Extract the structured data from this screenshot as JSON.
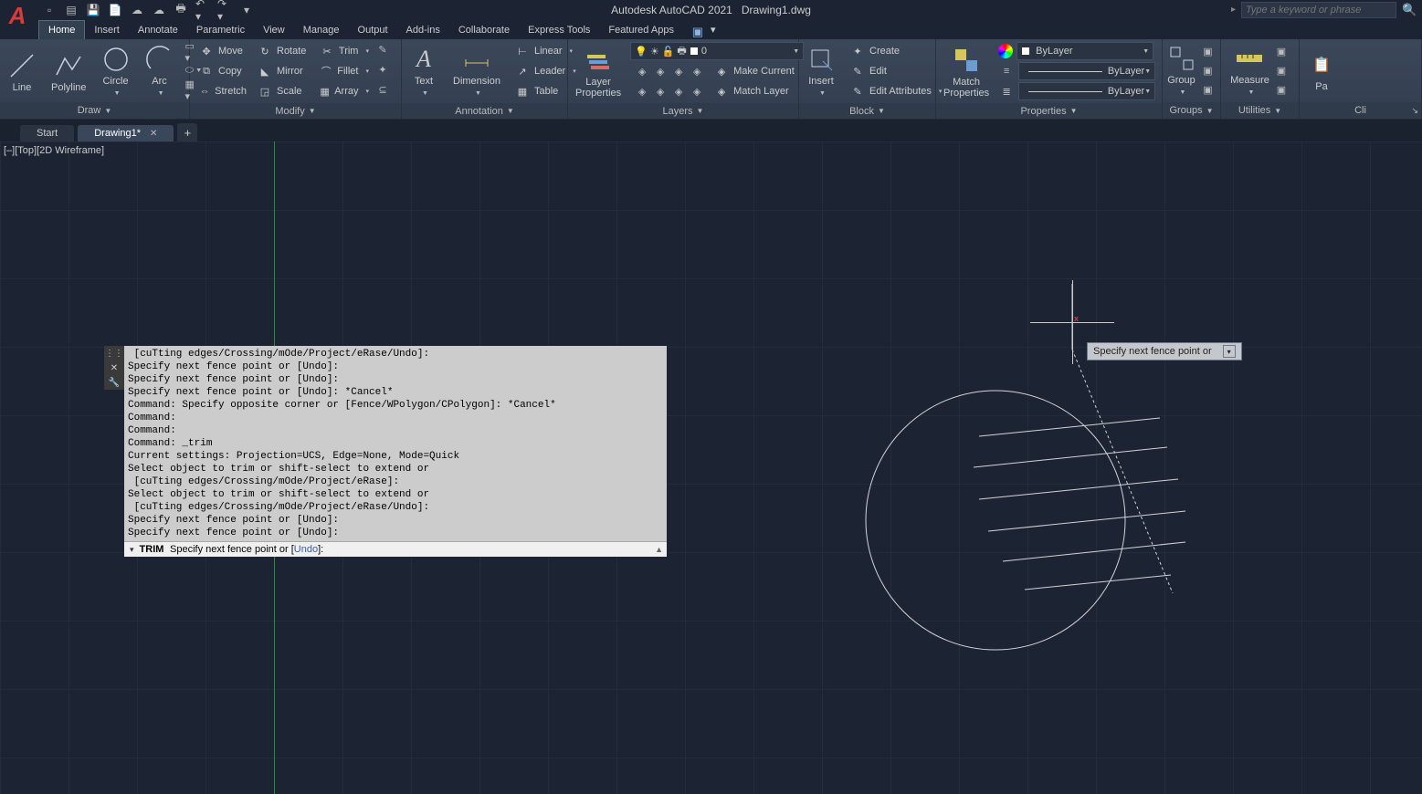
{
  "title_app": "Autodesk AutoCAD 2021",
  "title_doc": "Drawing1.dwg",
  "search_placeholder": "Type a keyword or phrase",
  "menutabs": [
    "Home",
    "Insert",
    "Annotate",
    "Parametric",
    "View",
    "Manage",
    "Output",
    "Add-ins",
    "Collaborate",
    "Express Tools",
    "Featured Apps"
  ],
  "active_menutab": 0,
  "panels": {
    "draw": {
      "label": "Draw",
      "btns": [
        "Line",
        "Polyline",
        "Circle",
        "Arc"
      ]
    },
    "modify": {
      "label": "Modify",
      "rows": [
        {
          "icon": "↔",
          "label": "Move"
        },
        {
          "icon": "↻",
          "label": "Rotate"
        },
        {
          "icon": "✂",
          "label": "Trim",
          "dd": true
        },
        {
          "icon": "⧉",
          "label": "Copy"
        },
        {
          "icon": "▲",
          "label": "Mirror"
        },
        {
          "icon": "⌒",
          "label": "Fillet",
          "dd": true
        },
        {
          "icon": "↔",
          "label": "Stretch"
        },
        {
          "icon": "⤢",
          "label": "Scale"
        },
        {
          "icon": "▦",
          "label": "Array",
          "dd": true
        }
      ]
    },
    "annotation": {
      "label": "Annotation",
      "text": "Text",
      "dim": "Dimension",
      "linear": "Linear",
      "leader": "Leader",
      "table": "Table"
    },
    "layers": {
      "label": "Layers",
      "lp": "Layer\nProperties",
      "make": "Make Current",
      "match": "Match Layer",
      "current": "0"
    },
    "block": {
      "label": "Block",
      "insert": "Insert",
      "create": "Create",
      "edit": "Edit",
      "attrs": "Edit Attributes"
    },
    "properties": {
      "label": "Properties",
      "match": "Match\nProperties",
      "bylayer": "ByLayer"
    },
    "groups": {
      "label": "Groups",
      "group": "Group"
    },
    "utilities": {
      "label": "Utilities",
      "measure": "Measure"
    },
    "clip": {
      "label": "Cli"
    }
  },
  "doctabs": [
    {
      "label": "Start",
      "active": false
    },
    {
      "label": "Drawing1*",
      "active": true
    }
  ],
  "viewport_label": "[–][Top][2D Wireframe]",
  "tooltip_text": "Specify next fence point or",
  "cmd_history": " [cuTting edges/Crossing/mOde/Project/eRase/Undo]:\nSpecify next fence point or [Undo]:\nSpecify next fence point or [Undo]:\nSpecify next fence point or [Undo]: *Cancel*\nCommand: Specify opposite corner or [Fence/WPolygon/CPolygon]: *Cancel*\nCommand:\nCommand:\nCommand: _trim\nCurrent settings: Projection=UCS, Edge=None, Mode=Quick\nSelect object to trim or shift-select to extend or\n [cuTting edges/Crossing/mOde/Project/eRase]:\nSelect object to trim or shift-select to extend or\n [cuTting edges/Crossing/mOde/Project/eRase/Undo]:\nSpecify next fence point or [Undo]:\nSpecify next fence point or [Undo]:",
  "cmd_line": {
    "cmd": "TRIM",
    "prompt": "Specify next fence point or [",
    "link": "Undo",
    "suffix": "]:"
  }
}
